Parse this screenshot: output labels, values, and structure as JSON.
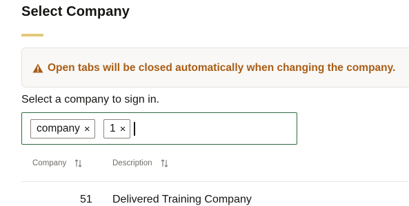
{
  "page": {
    "title": "Select Company"
  },
  "warning": {
    "message": "Open tabs will be closed automatically when changing the company.",
    "icon": "warning-triangle-icon",
    "color": "#a85d16"
  },
  "instruction": "Select a company to sign in.",
  "filter": {
    "chips": [
      {
        "label": "company",
        "remove": "×"
      },
      {
        "label": "1",
        "remove": "×"
      }
    ],
    "border_color": "#2e6b41"
  },
  "table": {
    "columns": [
      {
        "label": "Company",
        "sort_icon": "sort-arrows-icon"
      },
      {
        "label": "Description",
        "sort_icon": "sort-arrows-icon"
      }
    ],
    "rows": [
      {
        "company": "51",
        "description": "Delivered Training Company"
      }
    ]
  },
  "colors": {
    "title_accent": "#e4c87a"
  }
}
